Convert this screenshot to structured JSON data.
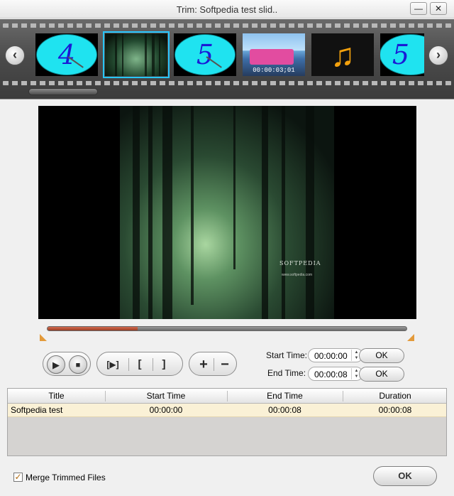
{
  "window": {
    "title": "Trim: Softpedia test slid..",
    "minimize_label": "—",
    "maximize_label": "☐",
    "close_label": "✕"
  },
  "filmstrip": {
    "prev_label": "‹",
    "next_label": "›",
    "thumbnails": [
      {
        "type": "clock",
        "label": "4"
      },
      {
        "type": "photo-forest",
        "selected": true
      },
      {
        "type": "clock",
        "label": "5"
      },
      {
        "type": "photo-bus",
        "time": "00:00:03;01"
      },
      {
        "type": "music",
        "glyph": "♫"
      },
      {
        "type": "clock",
        "label": "5"
      }
    ]
  },
  "preview": {
    "watermark": "SOFTPEDIA",
    "watermark_sub": "www.softpedia.com"
  },
  "timeline": {
    "progress": 0.25,
    "accent": "#b04a2c"
  },
  "controls": {
    "play": "▶",
    "stop": "■",
    "play_segment": "[▶]",
    "mark_in": "[",
    "mark_out": "]",
    "add": "+",
    "remove": "−",
    "start_time_label": "Start Time:",
    "start_time_value": "00:00:00",
    "end_time_label": "End Time:",
    "end_time_value": "00:00:08",
    "ok_start": "OK",
    "ok_end": "OK"
  },
  "table": {
    "columns": [
      "Title",
      "Start Time",
      "End Time",
      "Duration"
    ],
    "rows": [
      {
        "title": "Softpedia test",
        "start": "00:00:00",
        "end": "00:00:08",
        "duration": "00:00:08"
      }
    ]
  },
  "footer": {
    "merge_checked": true,
    "merge_label": "Merge Trimmed Files",
    "ok_label": "OK"
  }
}
